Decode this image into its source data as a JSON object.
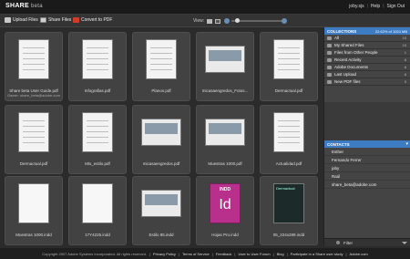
{
  "app": {
    "brand": "SHARE",
    "brand_sub": "beta"
  },
  "user_links": [
    "joby.sjs",
    "Help",
    "Sign Out"
  ],
  "toolbar": {
    "upload_label": "Upload Files",
    "share_label": "Share Files",
    "convert_label": "Convert to PDF",
    "view_label": "View:"
  },
  "files": [
    {
      "name": "Share beta User Guide.pdf",
      "sub": "Owner: share_beta@adobe.com",
      "kind": "doc"
    },
    {
      "name": "Infografias.pdf",
      "sub": "",
      "kind": "doc"
    },
    {
      "name": "Planos.pdf",
      "sub": "",
      "kind": "doc"
    },
    {
      "name": "micasaengredos_Fotos...",
      "sub": "",
      "kind": "wide"
    },
    {
      "name": "Dermactual.pdf",
      "sub": "",
      "kind": "doc"
    },
    {
      "name": "Dermactual.pdf",
      "sub": "",
      "kind": "doc"
    },
    {
      "name": "Mis_estilo.pdf",
      "sub": "",
      "kind": "doc"
    },
    {
      "name": "micasaengredos.pdf",
      "sub": "",
      "kind": "wide"
    },
    {
      "name": "Muestras 1000.pdf",
      "sub": "",
      "kind": "wide"
    },
    {
      "name": "Actualidad.pdf",
      "sub": "",
      "kind": "doc"
    },
    {
      "name": "Muestras 1000.indd",
      "sub": "",
      "kind": "blank"
    },
    {
      "name": "17Y4225.indd",
      "sub": "",
      "kind": "blank"
    },
    {
      "name": "Estilo 85.indd",
      "sub": "",
      "kind": "wide"
    },
    {
      "name": "Hojas Pro.indd",
      "sub": "",
      "kind": "indd"
    },
    {
      "name": "05_224x289.indd",
      "sub": "",
      "kind": "dark"
    }
  ],
  "indd_badge": "INDD",
  "indd_letter": "Id",
  "dark_thumb_label": "Dermactual",
  "collections": {
    "header": "COLLECTIONS",
    "usage": "22.62% of 1024 MB",
    "items": [
      {
        "label": "All",
        "count": "15"
      },
      {
        "label": "My Shared Files",
        "count": "15"
      },
      {
        "label": "Files from Other People",
        "count": "1"
      },
      {
        "label": "Recent Activity",
        "count": "8"
      },
      {
        "label": "Adobe Documents",
        "count": "8"
      },
      {
        "label": "Last Upload",
        "count": "8"
      },
      {
        "label": "New PDF files",
        "count": "5"
      }
    ]
  },
  "contacts": {
    "header": "CONTACTS",
    "items": [
      "Esther",
      "Fernando Ferrer",
      "joby",
      "Raúl",
      "share_beta@adobe.com"
    ],
    "filter_label": "Filter"
  },
  "footer": {
    "copyright": "Copyright 2007 Adobe Systems Incorporated. All rights reserved.",
    "links": [
      "Privacy Policy",
      "Terms of Service",
      "Feedback",
      "User to User Forum",
      "Blog",
      "Participate in a Share user study",
      "Adobe.com"
    ]
  },
  "colors": {
    "accent": "#3d7cc2",
    "pdf": "#d23b2a",
    "indd": "#b8308c"
  }
}
